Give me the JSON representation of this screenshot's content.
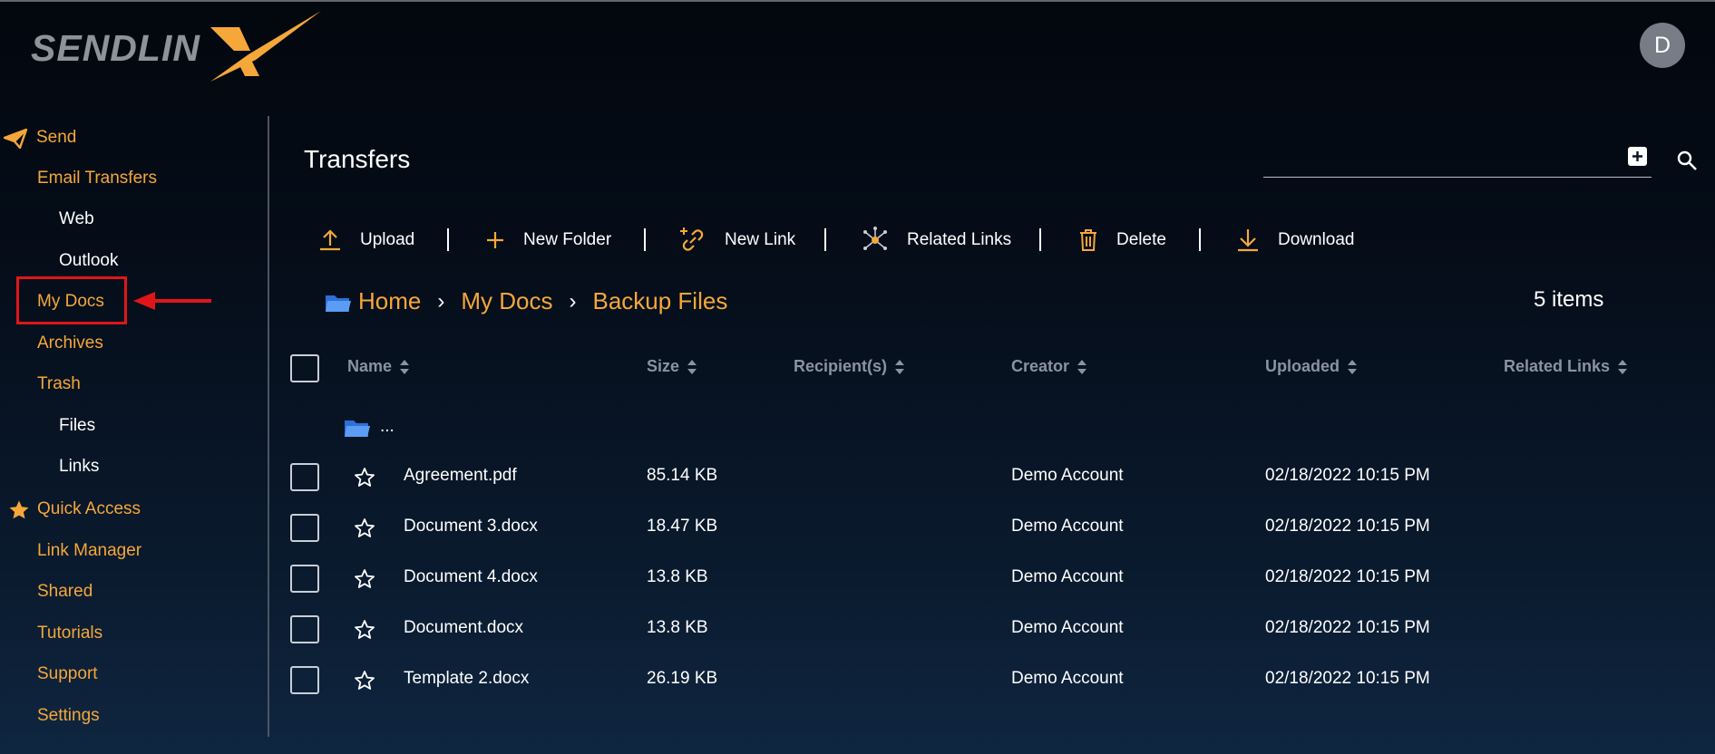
{
  "app": {
    "logo_text": "SENDLIN",
    "avatar_initial": "D"
  },
  "sidebar": {
    "items": [
      {
        "label": "Send",
        "color": "#f5a73a",
        "icon": "paper-plane-icon"
      },
      {
        "label": "Email Transfers",
        "color": "#f5a73a"
      },
      {
        "label": "Web",
        "color": "#ffffff"
      },
      {
        "label": "Outlook",
        "color": "#ffffff"
      },
      {
        "label": "My Docs",
        "color": "#f5a73a",
        "highlighted": true
      },
      {
        "label": "Archives",
        "color": "#f5a73a"
      },
      {
        "label": "Trash",
        "color": "#f5a73a"
      },
      {
        "label": "Files",
        "color": "#ffffff"
      },
      {
        "label": "Links",
        "color": "#ffffff"
      },
      {
        "label": "Quick Access",
        "color": "#f5a73a",
        "icon": "star-icon"
      },
      {
        "label": "Link Manager",
        "color": "#f5a73a"
      },
      {
        "label": "Shared",
        "color": "#f5a73a"
      },
      {
        "label": "Tutorials",
        "color": "#f5a73a"
      },
      {
        "label": "Support",
        "color": "#f5a73a"
      },
      {
        "label": "Settings",
        "color": "#f5a73a"
      }
    ]
  },
  "main": {
    "title": "Transfers",
    "search": {
      "placeholder": ""
    },
    "toolbar": [
      {
        "label": "Upload",
        "icon": "upload-icon"
      },
      {
        "label": "New Folder",
        "icon": "plus-icon"
      },
      {
        "label": "New Link",
        "icon": "add-link-icon"
      },
      {
        "label": "Related Links",
        "icon": "network-icon"
      },
      {
        "label": "Delete",
        "icon": "trash-icon"
      },
      {
        "label": "Download",
        "icon": "download-icon"
      }
    ],
    "breadcrumb": [
      "Home",
      "My Docs",
      "Backup Files"
    ],
    "items_count": "5 items",
    "columns": [
      "Name",
      "Size",
      "Recipient(s)",
      "Creator",
      "Uploaded",
      "Related Links"
    ],
    "parent_folder_label": "...",
    "rows": [
      {
        "name": "Agreement.pdf",
        "size": "85.14 KB",
        "recipients": "",
        "creator": "Demo Account",
        "uploaded": "02/18/2022 10:15 PM",
        "related": ""
      },
      {
        "name": "Document 3.docx",
        "size": "18.47 KB",
        "recipients": "",
        "creator": "Demo Account",
        "uploaded": "02/18/2022 10:15 PM",
        "related": ""
      },
      {
        "name": "Document 4.docx",
        "size": "13.8 KB",
        "recipients": "",
        "creator": "Demo Account",
        "uploaded": "02/18/2022 10:15 PM",
        "related": ""
      },
      {
        "name": "Document.docx",
        "size": "13.8 KB",
        "recipients": "",
        "creator": "Demo Account",
        "uploaded": "02/18/2022 10:15 PM",
        "related": ""
      },
      {
        "name": "Template 2.docx",
        "size": "26.19 KB",
        "recipients": "",
        "creator": "Demo Account",
        "uploaded": "02/18/2022 10:15 PM",
        "related": ""
      }
    ]
  },
  "colors": {
    "accent": "#f5a73a",
    "highlight": "#e0151a",
    "folder": "#3b82f6"
  }
}
